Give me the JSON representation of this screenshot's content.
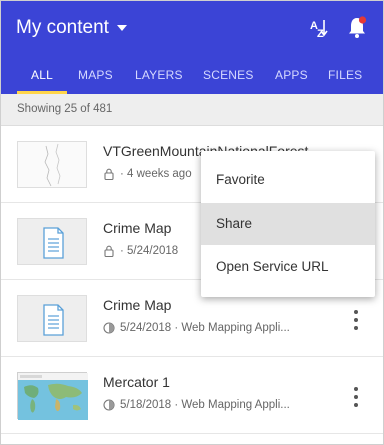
{
  "header": {
    "title": "My content",
    "sort_icon": "sort-alpha-icon",
    "notifications_icon": "bell-icon",
    "colors": {
      "brand": "#3b44d6",
      "tab_indicator": "#ffd54a",
      "notification_dot": "#e53935"
    }
  },
  "tabs": [
    {
      "label": "ALL",
      "active": true
    },
    {
      "label": "MAPS",
      "active": false
    },
    {
      "label": "LAYERS",
      "active": false
    },
    {
      "label": "SCENES",
      "active": false
    },
    {
      "label": "APPS",
      "active": false
    },
    {
      "label": "FILES",
      "active": false
    }
  ],
  "summary": {
    "text": "Showing 25 of 481"
  },
  "items": [
    {
      "title": "VTGreenMountainNationalForest",
      "meta": "· 4 weeks ago",
      "access_icon": "lock-icon",
      "thumbnail": "vector-map-thumbnail"
    },
    {
      "title": "Crime Map",
      "meta": "· 5/24/2018",
      "access_icon": "lock-icon",
      "thumbnail": "document-thumbnail"
    },
    {
      "title": "Crime Map",
      "meta": "5/24/2018 · Web Mapping Appli...",
      "access_icon": "shared-icon",
      "thumbnail": "document-thumbnail"
    },
    {
      "title": "Mercator 1",
      "meta": "5/18/2018 · Web Mapping Appli...",
      "access_icon": "shared-icon",
      "thumbnail": "world-map-thumbnail"
    }
  ],
  "context_menu": {
    "items": [
      {
        "label": "Favorite",
        "highlighted": false
      },
      {
        "label": "Share",
        "highlighted": true
      },
      {
        "label": "Open Service URL",
        "highlighted": false
      }
    ]
  }
}
